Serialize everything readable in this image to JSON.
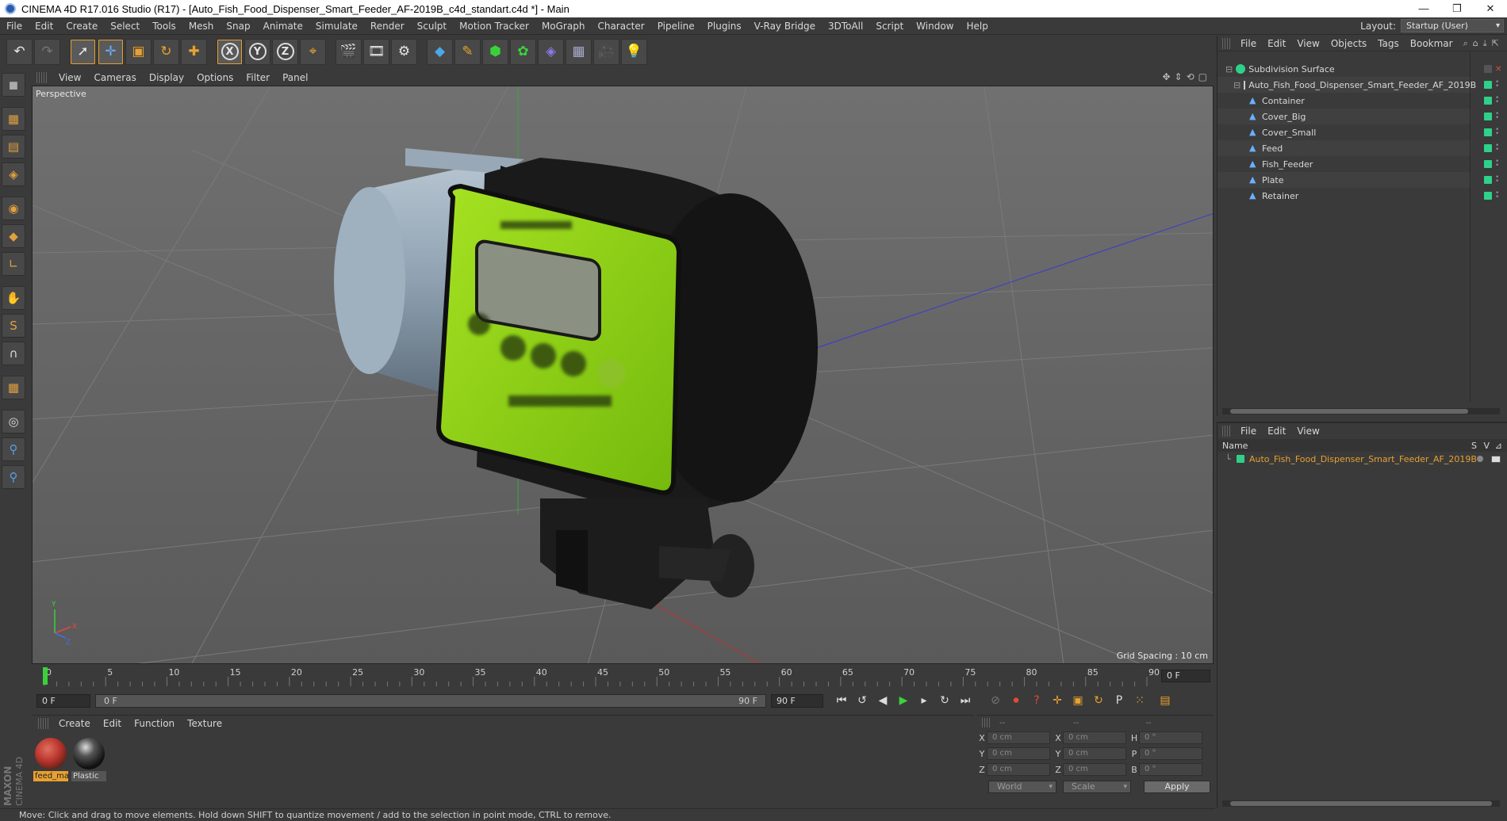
{
  "window": {
    "title": "CINEMA 4D R17.016 Studio (R17) - [Auto_Fish_Food_Dispenser_Smart_Feeder_AF-2019B_c4d_standart.c4d *] - Main",
    "minimize": "—",
    "restore": "❐",
    "close": "✕"
  },
  "menu": [
    "File",
    "Edit",
    "Create",
    "Select",
    "Tools",
    "Mesh",
    "Snap",
    "Animate",
    "Simulate",
    "Render",
    "Sculpt",
    "Motion Tracker",
    "MoGraph",
    "Character",
    "Pipeline",
    "Plugins",
    "V-Ray Bridge",
    "3DToAll",
    "Script",
    "Window",
    "Help"
  ],
  "layout": {
    "label": "Layout:",
    "value": "Startup (User)"
  },
  "toolbar": {
    "undo": "↶",
    "redo": "↷",
    "select": "➚",
    "move": "✛",
    "scale": "▣",
    "rotate": "↻",
    "last_tool": "✚",
    "x": "X",
    "y": "Y",
    "z": "Z",
    "coord": "⌖",
    "render_view": "🎬",
    "render": "🎞",
    "render_settings": "⚙",
    "cube": "◆",
    "pen": "✎",
    "subdiv": "⬢",
    "array": "✿",
    "deformer": "◈",
    "floor": "▦",
    "camera": "🎥",
    "light": "💡"
  },
  "lefttools": [
    "◼",
    "▦",
    "▤",
    "◈",
    "◉",
    "◆",
    "∟",
    "✋",
    "S",
    "∩",
    "▦",
    "◎",
    "⚲",
    "⚲"
  ],
  "viewport": {
    "menu": [
      "View",
      "Cameras",
      "Display",
      "Options",
      "Filter",
      "Panel"
    ],
    "nav_icons": [
      "✥",
      "⇕",
      "⟲",
      "▢"
    ],
    "label": "Perspective",
    "grid_spacing": "Grid Spacing : 10 cm",
    "axis_y": "Y",
    "axis_x": "X",
    "axis_z": "Z"
  },
  "timeline": {
    "ticks": [
      "0",
      "5",
      "10",
      "15",
      "20",
      "25",
      "30",
      "35",
      "40",
      "45",
      "50",
      "55",
      "60",
      "65",
      "70",
      "75",
      "80",
      "85",
      "90"
    ],
    "current_frame": "0 F"
  },
  "transport": {
    "start": "0 F",
    "slider_left": "0 F",
    "slider_right": "90 F",
    "end": "90 F",
    "buttons": [
      "⏮",
      "↺",
      "◀",
      "▶",
      "▸",
      "↻",
      "⏭"
    ],
    "key_buttons": [
      "⊘",
      "⏺",
      "?",
      "✛",
      "▣",
      "↻",
      "P",
      "⁙",
      "▤"
    ]
  },
  "materials": {
    "menu": [
      "Create",
      "Edit",
      "Function",
      "Texture"
    ],
    "items": [
      {
        "name": "feed_ma",
        "color": "#b8342c"
      },
      {
        "name": "Plastic",
        "color": "#1e1e1e"
      }
    ]
  },
  "coordinates": {
    "headers": [
      "--",
      "--",
      "--"
    ],
    "rows": [
      {
        "a": "X",
        "v1": "0 cm",
        "b": "X",
        "v2": "0 cm",
        "c": "H",
        "v3": "0 °"
      },
      {
        "a": "Y",
        "v1": "0 cm",
        "b": "Y",
        "v2": "0 cm",
        "c": "P",
        "v3": "0 °"
      },
      {
        "a": "Z",
        "v1": "0 cm",
        "b": "Z",
        "v2": "0 cm",
        "c": "B",
        "v3": "0 °"
      }
    ],
    "world": "World",
    "scale": "Scale",
    "apply": "Apply"
  },
  "status": "Move: Click and drag to move elements. Hold down SHIFT to quantize movement / add to the selection in point mode, CTRL to remove.",
  "objects": {
    "menu": [
      "File",
      "Edit",
      "View",
      "Objects",
      "Tags",
      "Bookmar"
    ],
    "icons": [
      "⌕",
      "⌂",
      "⤓",
      "⇱"
    ],
    "tree": [
      {
        "name": "Subdivision Surface",
        "level": 0
      },
      {
        "name": "Auto_Fish_Food_Dispenser_Smart_Feeder_AF_2019B",
        "level": 1
      },
      {
        "name": "Container",
        "level": 2
      },
      {
        "name": "Cover_Big",
        "level": 2
      },
      {
        "name": "Cover_Small",
        "level": 2
      },
      {
        "name": "Feed",
        "level": 2
      },
      {
        "name": "Fish_Feeder",
        "level": 2
      },
      {
        "name": "Plate",
        "level": 2
      },
      {
        "name": "Retainer",
        "level": 2
      }
    ]
  },
  "attributes": {
    "menu": [
      "File",
      "Edit",
      "View"
    ],
    "col_name": "Name",
    "col_s": "S",
    "col_v": "V",
    "col_extra": "⊿",
    "row": "Auto_Fish_Food_Dispenser_Smart_Feeder_AF_2019B"
  },
  "brand": "MAXON CINEMA 4D",
  "colors": {
    "accent": "#e8a030",
    "green": "#2fd08a",
    "feeder_green": "#8ccf1a"
  }
}
